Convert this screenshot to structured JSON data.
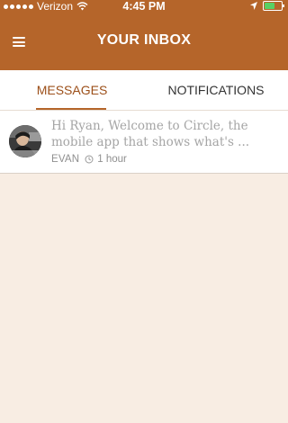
{
  "status_bar": {
    "carrier": "Verizon",
    "time": "4:45 PM",
    "signal_icon": "signal-dots-icon",
    "wifi_icon": "wifi-icon",
    "location_icon": "location-arrow-icon",
    "battery_icon": "battery-icon",
    "battery_level": 0.6,
    "battery_color": "#58d163"
  },
  "header": {
    "title": "YOUR INBOX",
    "menu_icon": "hamburger-menu-icon",
    "background_color": "#b5652a"
  },
  "tabs": [
    {
      "label": "MESSAGES",
      "active": true
    },
    {
      "label": "NOTIFICATIONS",
      "active": false
    }
  ],
  "messages": [
    {
      "preview_line1": "Hi Ryan, Welcome to Circle, the",
      "preview_line2": "mobile app that shows what's ...",
      "sender": "EVAN",
      "time_icon": "clock-icon",
      "time": "1 hour",
      "avatar": "avatar-photo"
    }
  ],
  "colors": {
    "accent": "#b5652a",
    "active_tab_text": "#9c4f19",
    "page_background": "#f8ede3"
  }
}
